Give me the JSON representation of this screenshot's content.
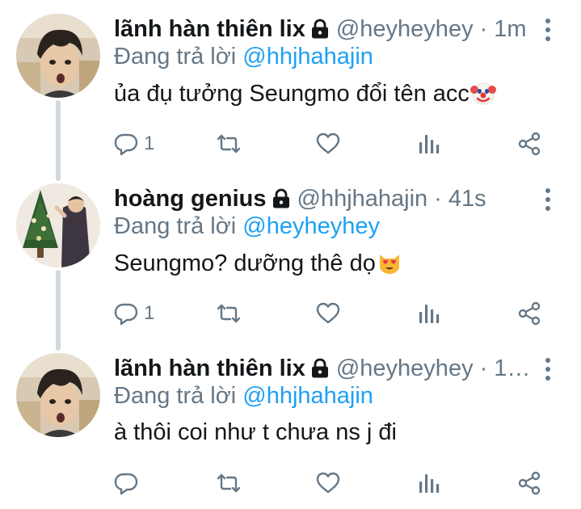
{
  "tweets": [
    {
      "name": "lãnh hàn thiên lix",
      "handle": "@heyheyhey",
      "dot": "·",
      "time": "1m",
      "reply_prefix": "Đang trả lời",
      "reply_to": "@hhjhahajin",
      "text": "ủa đụ tưởng Seungmo đổi tên acc",
      "emoji": "clown-face",
      "reply_count": "1",
      "retweet_count": "",
      "like_count": "",
      "avatar": "boy-selfie"
    },
    {
      "name": "hoàng genius",
      "handle": "@hhjhahajin",
      "dot": "·",
      "time": "41s",
      "reply_prefix": "Đang trả lời",
      "reply_to": "@heyheyhey",
      "text": "Seungmo? dưỡng thê dọ",
      "emoji": "heart-eyes-cat",
      "reply_count": "1",
      "retweet_count": "",
      "like_count": "",
      "avatar": "christmas-tree"
    },
    {
      "name": "lãnh hàn thiên lix",
      "handle": "@heyheyhey",
      "dot": "·",
      "time": "1…",
      "reply_prefix": "Đang trả lời",
      "reply_to": "@hhjhahajin",
      "text": "à thôi coi như t chưa ns j đi",
      "emoji": "",
      "reply_count": "",
      "retweet_count": "",
      "like_count": "",
      "avatar": "boy-selfie"
    }
  ],
  "colors": {
    "text": "#14171a",
    "secondary": "#657786",
    "link": "#1da1f2",
    "thread": "#cfd9de"
  }
}
